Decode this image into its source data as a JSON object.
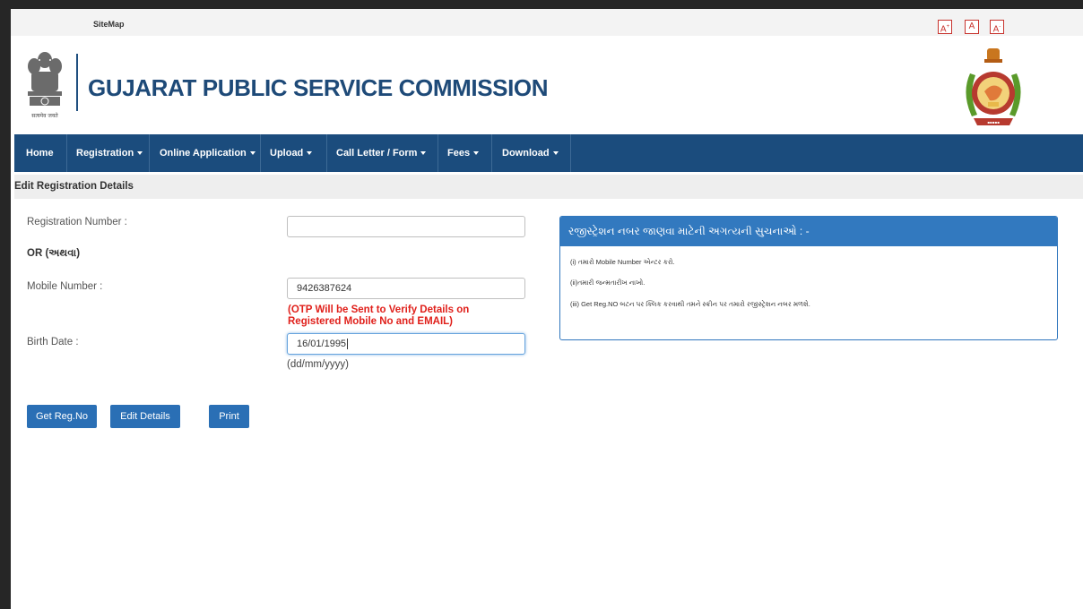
{
  "topbar": {
    "sitemap_label": "SiteMap",
    "font_controls": [
      "A+",
      "A",
      "A-"
    ]
  },
  "header": {
    "title": "GUJARAT PUBLIC SERVICE COMMISSION",
    "emblem_motto": "सत्यमेव जयते",
    "emblem_icon": "national-emblem-icon",
    "logo_icon": "gpsc-logo-icon"
  },
  "nav": {
    "items": [
      {
        "label": "Home",
        "dropdown": false
      },
      {
        "label": "Registration",
        "dropdown": true
      },
      {
        "label": "Online Application",
        "dropdown": true
      },
      {
        "label": "Upload",
        "dropdown": true
      },
      {
        "label": "Call Letter / Form",
        "dropdown": true
      },
      {
        "label": "Fees",
        "dropdown": true
      },
      {
        "label": "Download",
        "dropdown": true
      }
    ]
  },
  "page": {
    "title": "Edit Registration Details"
  },
  "form": {
    "registration_label": "Registration Number :",
    "registration_value": "",
    "or_label": "OR (અથવા)",
    "mobile_label": "Mobile Number :",
    "mobile_value": "9426387624",
    "otp_note": "(OTP Will be Sent to Verify Details on Registered Mobile No and EMAIL)",
    "birth_label": "Birth Date :",
    "birth_value": "16/01/1995",
    "date_hint": "(dd/mm/yyyy)"
  },
  "buttons": {
    "get_reg_label": "Get Reg.No",
    "edit_details_label": "Edit Details",
    "print_label": "Print"
  },
  "info_panel": {
    "heading": "રજીસ્ટ્રેશન નબર જાણવા માટેની અગત્યની સુચનાઓ : -",
    "lines": [
      "(i) તમારો Mobile Number એન્ટર કરો.",
      "(ii)તમારી જન્મતારીખ નાખો.",
      "(iii) Get Reg.NO બટન પર ક્લિક કરવાથી તમને સ્ક્રીન પર તમારો રજીસ્ટ્રેશન નબર મળશે."
    ]
  },
  "colors": {
    "nav_bg": "#1b4c7d",
    "title_color": "#1e4a78",
    "button_bg": "#2a6fb5",
    "otp_red": "#e0201b",
    "panel_head": "#3279bf",
    "font_control_red": "#c8342e"
  }
}
